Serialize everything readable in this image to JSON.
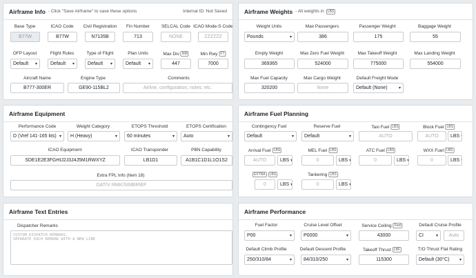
{
  "info": {
    "title": "Airframe Info",
    "subtitle": "- Click \"Save Airframe\" to save these options",
    "internal_id": "Internal ID: Not Saved",
    "labels": [
      "Base Type",
      "ICAO Code",
      "Civil Registration",
      "Fin Number",
      "SELCAL Code",
      "ICAO Mode-S Code",
      "OFP Layout",
      "Flight Rules",
      "Type of Flight",
      "Plan Units",
      "Max Div",
      "Min Rwy",
      "Aircraft Name",
      "Engine Type",
      "Comments"
    ],
    "values": {
      "base_type": "B77W",
      "icao_code": "B77W",
      "civil_reg": "N7135B",
      "fin": "713",
      "selcal_ph": "NONE",
      "modes_ph": "ZZZZZZ",
      "ofp": "Default",
      "rules": "Default",
      "type": "Default",
      "units": "Default",
      "max_div": "447",
      "min_rwy": "7000",
      "aircraft_name": "B777-300ER",
      "engine": "GE90-115BL2",
      "comments_ph": "Airline, configuration, notes, etc."
    },
    "badges": {
      "max_div": "NM",
      "min_rwy": "FT"
    }
  },
  "weights": {
    "title": "Airframe Weights",
    "subtitle": "- All weights in",
    "unit_badge": "LBS",
    "labels": [
      "Weight Units",
      "Max Passengers",
      "Passenger Weight",
      "Baggage Weight",
      "Empty Weight",
      "Max Zero Fuel Weight",
      "Max Takeoff Weight",
      "Max Landing Weight",
      "Max Fuel Capacity",
      "Max Cargo Weight",
      "Default Freight Mode"
    ],
    "values": {
      "units": "Pounds",
      "max_pax": "386",
      "pax_wt": "175",
      "bag_wt": "55",
      "empty": "369365",
      "mzfw": "524000",
      "mtow": "775000",
      "mlw": "554000",
      "fuel_cap": "320200",
      "cargo_ph": "None",
      "freight": "Default (None)"
    }
  },
  "equip": {
    "title": "Airframe Equipment",
    "labels": [
      "Performance Code",
      "Weight Category",
      "ETOPS Threshold",
      "ETOPS Certification",
      "ICAO Equipment",
      "ICAO Transponder",
      "PBN Capability",
      "Extra FPL Info (Item 18)"
    ],
    "values": {
      "perf": "D (Vref 141-165 kts)",
      "wcat": "H (Heavy)",
      "etops_t": "60 minutes",
      "etops_c": "Auto",
      "equipment": "SDE1E2E3FGHIJ2J3J4J5M1RWXYZ",
      "transponder": "LB1D1",
      "pbn": "A1B1C1D1L1O1S2",
      "extra_ph": "DAT/V RMK/SIMBRIEF"
    }
  },
  "fuel": {
    "title": "Airframe Fuel Planning",
    "labels": [
      "Contingency Fuel",
      "Reserve Fuel",
      "Taxi Fuel",
      "Block Fuel",
      "Arrival Fuel",
      "MEL Fuel",
      "ATC Fuel",
      "WXX Fuel",
      "Tankering"
    ],
    "values": {
      "contingency": "Default",
      "reserve": "Default",
      "auto": "AUTO",
      "zero": "0",
      "lbs": "LBS",
      "extra": "EXTRA"
    }
  },
  "text": {
    "title": "Airframe Text Entries",
    "label": "Dispatcher Remarks",
    "placeholder": "CUSTOM DISPATCH REMARKS.\nSEPARATE EACH REMARK WITH A NEW LINE"
  },
  "perf": {
    "title": "Airframe Performance",
    "labels": [
      "Fuel Factor",
      "Cruise Level Offset",
      "Service Ceiling",
      "Default Cruise Profile",
      "Default Climb Profile",
      "Default Descent Profile",
      "Takeoff Thrust",
      "T/O Thrust Flat Rating"
    ],
    "badges": {
      "ceiling": "Feet",
      "thrust": "LBF"
    },
    "values": {
      "factor": "P00",
      "offset": "P0000",
      "ceiling": "43000",
      "cruise": "CI",
      "cruise_ph": "Auto",
      "climb": "250/310/84",
      "descent": "84/310/250",
      "thrust": "115300",
      "flat": "Default (30°C)"
    }
  }
}
